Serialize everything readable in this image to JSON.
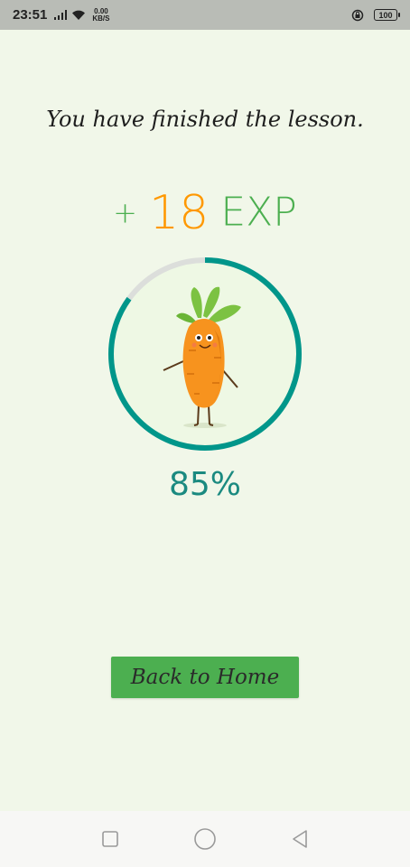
{
  "status_bar": {
    "time": "23:51",
    "net_speed_value": "0.00",
    "net_speed_unit": "KB/S",
    "battery": "100",
    "icons": [
      "signal-icon",
      "wifi-icon",
      "rotation-lock-icon",
      "battery-icon"
    ]
  },
  "lesson": {
    "message": "You have finished the lesson.",
    "exp_plus": "+",
    "exp_amount": "18",
    "exp_unit": "EXP",
    "progress": 0.85,
    "percent_label": "85%",
    "mascot": "carrot-mascot"
  },
  "actions": {
    "home_label": "Back to Home"
  },
  "colors": {
    "background": "#f1f7e9",
    "accent_green": "#4caf50",
    "exp_orange": "#ff9800",
    "progress_teal": "#00968a",
    "progress_track": "#dcdedb",
    "carrot_orange": "#f7931e",
    "leaf_green": "#7cc242"
  },
  "nav_bar": {
    "icons": [
      "recents-square-icon",
      "home-circle-icon",
      "back-triangle-icon"
    ]
  }
}
